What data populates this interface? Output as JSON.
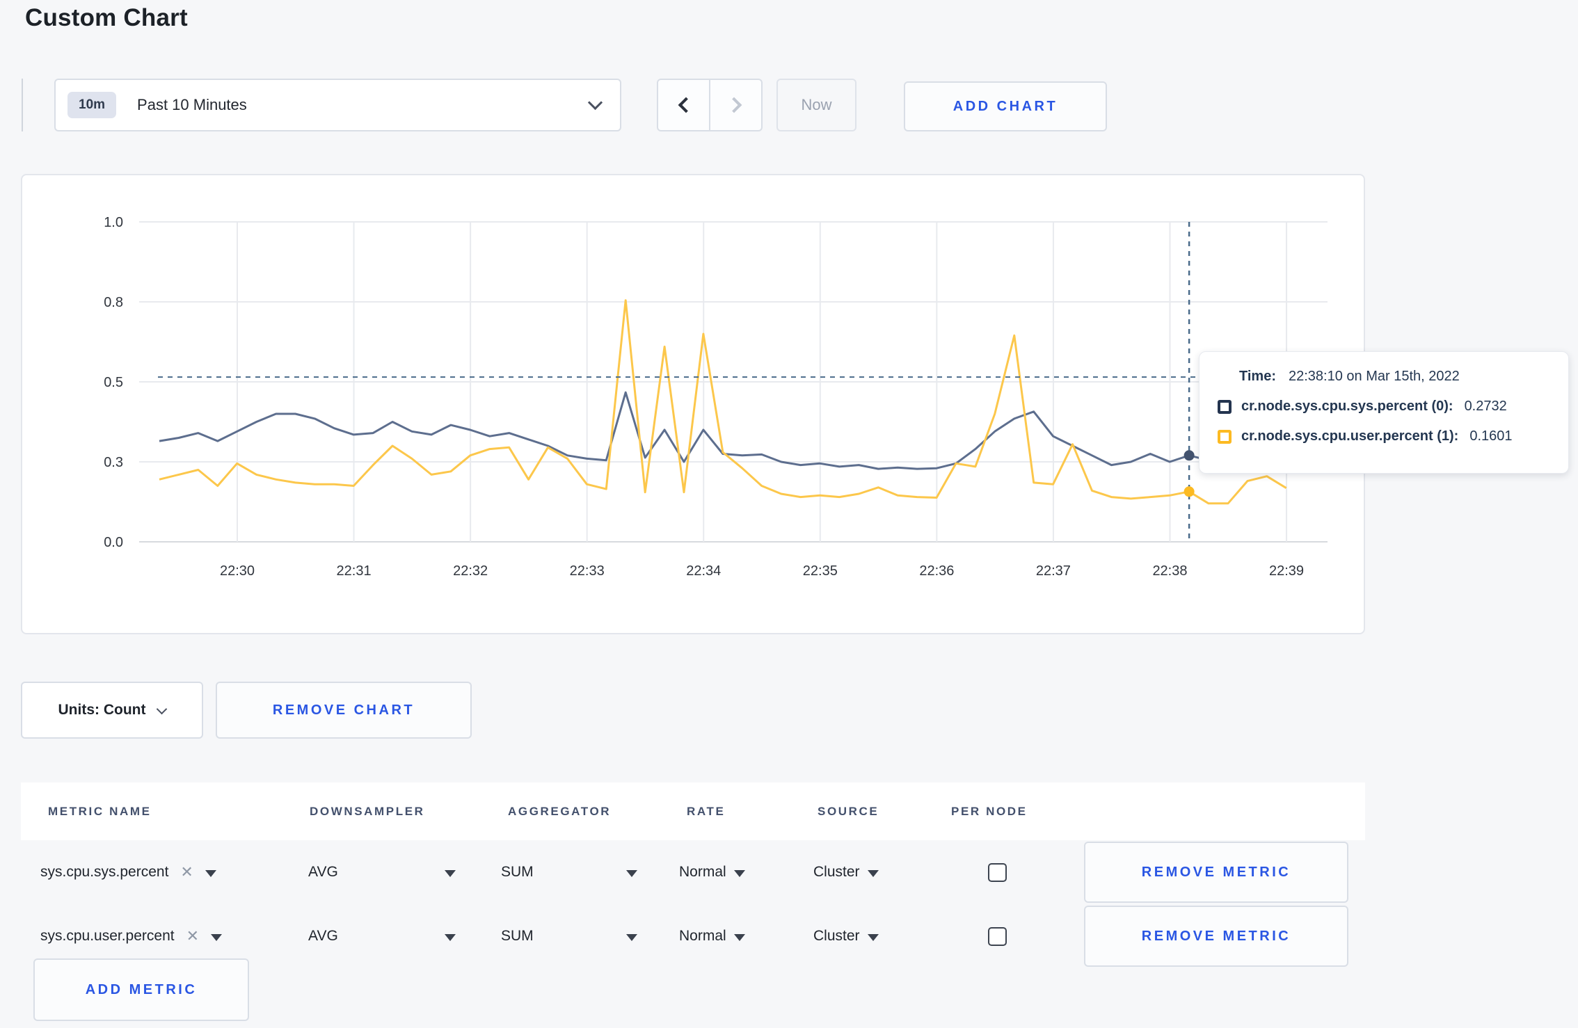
{
  "page": {
    "title": "Custom Chart"
  },
  "toolbar": {
    "time_range": {
      "badge": "10m",
      "label": "Past 10 Minutes"
    },
    "now_label": "Now",
    "add_chart_label": "ADD CHART"
  },
  "chart_data": {
    "type": "line",
    "title": "",
    "xlabel": "",
    "ylabel": "",
    "ylim": [
      0,
      1
    ],
    "grid": true,
    "y_tick_values": [
      0,
      0.25,
      0.5,
      0.75,
      1.0
    ],
    "y_tick_labels": [
      "0.0",
      "0.3",
      "0.5",
      "0.8",
      "1.0"
    ],
    "x_ticks": [
      "22:30",
      "22:31",
      "22:32",
      "22:33",
      "22:34",
      "22:35",
      "22:36",
      "22:37",
      "22:38",
      "22:39"
    ],
    "x_window": {
      "start": "22:29:20",
      "step_sec": 10
    },
    "series": [
      {
        "name": "cr.node.sys.cpu.sys.percent",
        "color": "#5d6e8e",
        "values": [
          0.315,
          0.325,
          0.34,
          0.315,
          0.345,
          0.375,
          0.4,
          0.4,
          0.385,
          0.355,
          0.335,
          0.34,
          0.375,
          0.345,
          0.335,
          0.365,
          0.35,
          0.33,
          0.34,
          0.32,
          0.3,
          0.27,
          0.26,
          0.255,
          0.467,
          0.263,
          0.35,
          0.25,
          0.35,
          0.275,
          0.27,
          0.273,
          0.25,
          0.24,
          0.245,
          0.235,
          0.24,
          0.228,
          0.232,
          0.228,
          0.23,
          0.245,
          0.29,
          0.345,
          0.385,
          0.407,
          0.33,
          0.3,
          0.27,
          0.24,
          0.25,
          0.275,
          0.25,
          0.27,
          0.255,
          0.25,
          0.26,
          0.265,
          0.26,
          0.255
        ]
      },
      {
        "name": "cr.node.sys.cpu.user.percent",
        "color": "#fcc74b",
        "values": [
          0.195,
          0.21,
          0.225,
          0.175,
          0.245,
          0.21,
          0.195,
          0.185,
          0.18,
          0.18,
          0.175,
          0.24,
          0.3,
          0.26,
          0.21,
          0.22,
          0.27,
          0.29,
          0.295,
          0.195,
          0.295,
          0.26,
          0.18,
          0.165,
          0.755,
          0.155,
          0.61,
          0.155,
          0.65,
          0.28,
          0.23,
          0.175,
          0.15,
          0.14,
          0.145,
          0.14,
          0.15,
          0.17,
          0.145,
          0.14,
          0.138,
          0.245,
          0.235,
          0.4,
          0.645,
          0.185,
          0.18,
          0.305,
          0.16,
          0.14,
          0.135,
          0.14,
          0.145,
          0.157,
          0.12,
          0.12,
          0.19,
          0.205,
          0.168
        ]
      }
    ],
    "crosshair": {
      "time": "22:38:10",
      "sample_index": 53,
      "h_line_value": 0.515
    },
    "legend_position": "tooltip"
  },
  "tooltip": {
    "time_label": "Time:",
    "time_value": "22:38:10 on Mar 15th, 2022",
    "series": [
      {
        "name": "cr.node.sys.cpu.sys.percent (0):",
        "value": "0.2732",
        "swatch_color": "#24344f"
      },
      {
        "name": "cr.node.sys.cpu.user.percent (1):",
        "value": "0.1601",
        "swatch_color": "#fcba22"
      }
    ]
  },
  "chart_controls": {
    "units_label": "Units: Count",
    "remove_chart_label": "REMOVE CHART",
    "add_metric_label": "ADD METRIC"
  },
  "metrics_table": {
    "headers": [
      "METRIC NAME",
      "DOWNSAMPLER",
      "AGGREGATOR",
      "RATE",
      "SOURCE",
      "PER NODE"
    ],
    "rows": [
      {
        "metric_name": "sys.cpu.sys.percent",
        "downsampler": "AVG",
        "aggregator": "SUM",
        "rate": "Normal",
        "source": "Cluster",
        "per_node_checked": false,
        "remove_label": "REMOVE METRIC"
      },
      {
        "metric_name": "sys.cpu.user.percent",
        "downsampler": "AVG",
        "aggregator": "SUM",
        "rate": "Normal",
        "source": "Cluster",
        "per_node_checked": false,
        "remove_label": "REMOVE METRIC"
      }
    ]
  },
  "colors": {
    "accent_blue": "#2a56e3",
    "page_bg": "#f6f7f9",
    "grid_line": "#e8eaee",
    "axis_line": "#d7dade",
    "crosshair": "#4a6b8a"
  }
}
